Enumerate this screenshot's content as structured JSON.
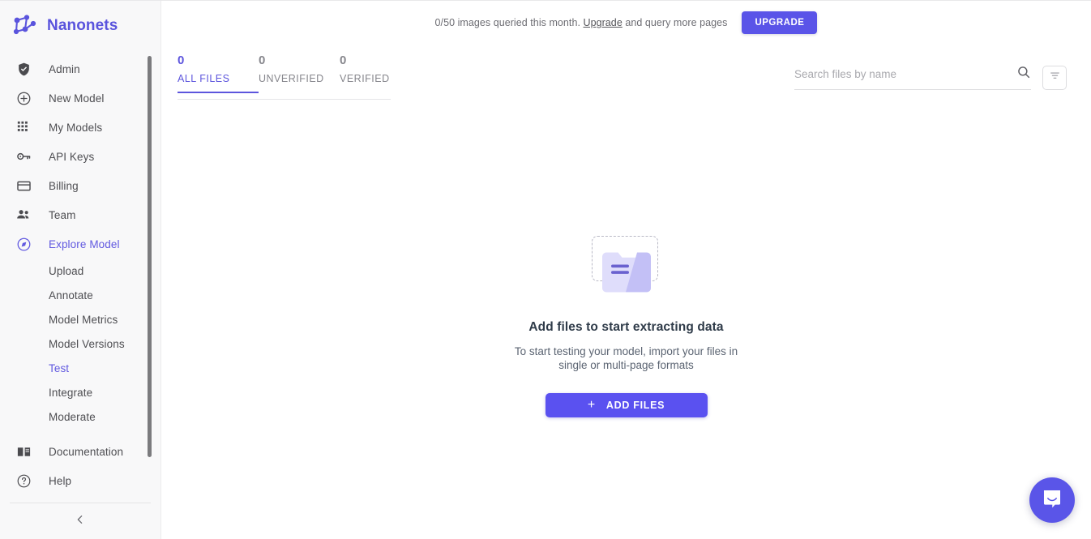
{
  "brand": {
    "name": "Nanonets",
    "logo_icon": "nanonets-network-logo",
    "color": "#5a54dd"
  },
  "sidebar": {
    "items": [
      {
        "label": "Admin",
        "icon": "shield-check-icon",
        "active": false
      },
      {
        "label": "New Model",
        "icon": "plus-circle-icon",
        "active": false
      },
      {
        "label": "My Models",
        "icon": "grid-dots-icon",
        "active": false
      },
      {
        "label": "API Keys",
        "icon": "key-icon",
        "active": false
      },
      {
        "label": "Billing",
        "icon": "credit-card-icon",
        "active": false
      },
      {
        "label": "Team",
        "icon": "people-icon",
        "active": false
      },
      {
        "label": "Explore Model",
        "icon": "compass-icon",
        "active": true
      }
    ],
    "sub_items": [
      {
        "label": "Upload",
        "active": false
      },
      {
        "label": "Annotate",
        "active": false
      },
      {
        "label": "Model Metrics",
        "active": false
      },
      {
        "label": "Model Versions",
        "active": false
      },
      {
        "label": "Test",
        "active": true
      },
      {
        "label": "Integrate",
        "active": false
      },
      {
        "label": "Moderate",
        "active": false
      }
    ],
    "footer_items": [
      {
        "label": "Documentation",
        "icon": "book-icon"
      },
      {
        "label": "Help",
        "icon": "question-circle-icon"
      }
    ],
    "collapse_icon": "chevron-left-icon",
    "active_color": "#6159e0"
  },
  "topbar": {
    "quota_prefix": "0/50 images queried this month. ",
    "quota_link": "Upgrade",
    "quota_suffix": " and query more pages",
    "upgrade_button": "UPGRADE",
    "upgrade_color": "#5a54e8"
  },
  "tabs": [
    {
      "count": "0",
      "label": "ALL FILES",
      "active": true
    },
    {
      "count": "0",
      "label": "UNVERIFIED",
      "active": false
    },
    {
      "count": "0",
      "label": "VERIFIED",
      "active": false
    }
  ],
  "search": {
    "placeholder": "Search files by name",
    "value": "",
    "search_icon": "search-icon",
    "filter_icon": "filter-funnel-icon"
  },
  "empty_state": {
    "illustration": "dashed-box-with-folder-icon",
    "title": "Add files to start extracting data",
    "subtitle": "To start testing your model, import your files in single or multi-page formats",
    "button_label": "ADD FILES",
    "button_icon": "plus-icon",
    "button_color": "#5a51f0"
  },
  "chat": {
    "launcher_icon": "intercom-chat-icon",
    "color": "#5a55e8"
  }
}
